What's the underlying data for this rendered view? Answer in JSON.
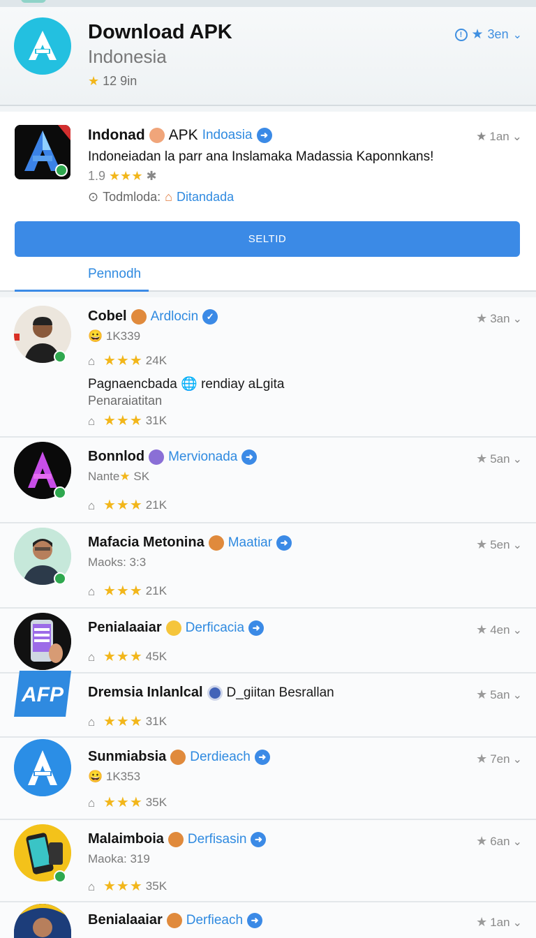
{
  "header": {
    "title": "Download APK",
    "subtitle": "Indonesia",
    "rating": "12 9in",
    "actions_text": "3en"
  },
  "featured": {
    "title_part1": "Indonad",
    "title_part2": "APK",
    "title_link": "Indoasia",
    "description": "Indoneiadan la parr ana Inslamaka Madassia Kaponnkans!",
    "rating_value": "1.9",
    "meta_label": "Todmloda:",
    "meta_link": "Ditandada",
    "time": "1an",
    "select_button": "SELTID",
    "tab_label": "Pennodh"
  },
  "items": [
    {
      "name": "Cobel",
      "category": "Ardlocin",
      "line2": "1K339",
      "stat1": "24K",
      "desc": "Pagnaencbada",
      "desc_b": "rendiay aLgita",
      "desc2": "Penaraiatitan",
      "stat2": "31K",
      "time": "3an"
    },
    {
      "name": "Bonnlod",
      "category": "Mervionada",
      "line2": "Nante",
      "line2b": "SK",
      "stat1": "21K",
      "time": "5an"
    },
    {
      "name": "Mafacia Metonina",
      "category": "Maatiar",
      "line2": "Maoks: 3:3",
      "stat1": "21K",
      "time": "5en"
    },
    {
      "name": "Penialaaiar",
      "category": "Derficacia",
      "stat1": "45K",
      "time": "4en"
    },
    {
      "name": "Dremsia Inlanlcal",
      "category": "D_giitan Besrallan",
      "stat1": "31K",
      "time": "5an",
      "logo_text": "AFP"
    },
    {
      "name": "Sunmiabsia",
      "category": "Derdieach",
      "line2": "1K353",
      "stat1": "35K",
      "time": "7en"
    },
    {
      "name": "Malaimboia",
      "category": "Derfisasin",
      "line2": "Maoka: 319",
      "stat1": "35K",
      "time": "6an"
    },
    {
      "name": "Benialaaiar",
      "category": "Derfieach",
      "time": "1an"
    }
  ],
  "colors": {
    "accent": "#3b8ae6",
    "star": "#f2b61a",
    "logo": "#23c0e0"
  }
}
